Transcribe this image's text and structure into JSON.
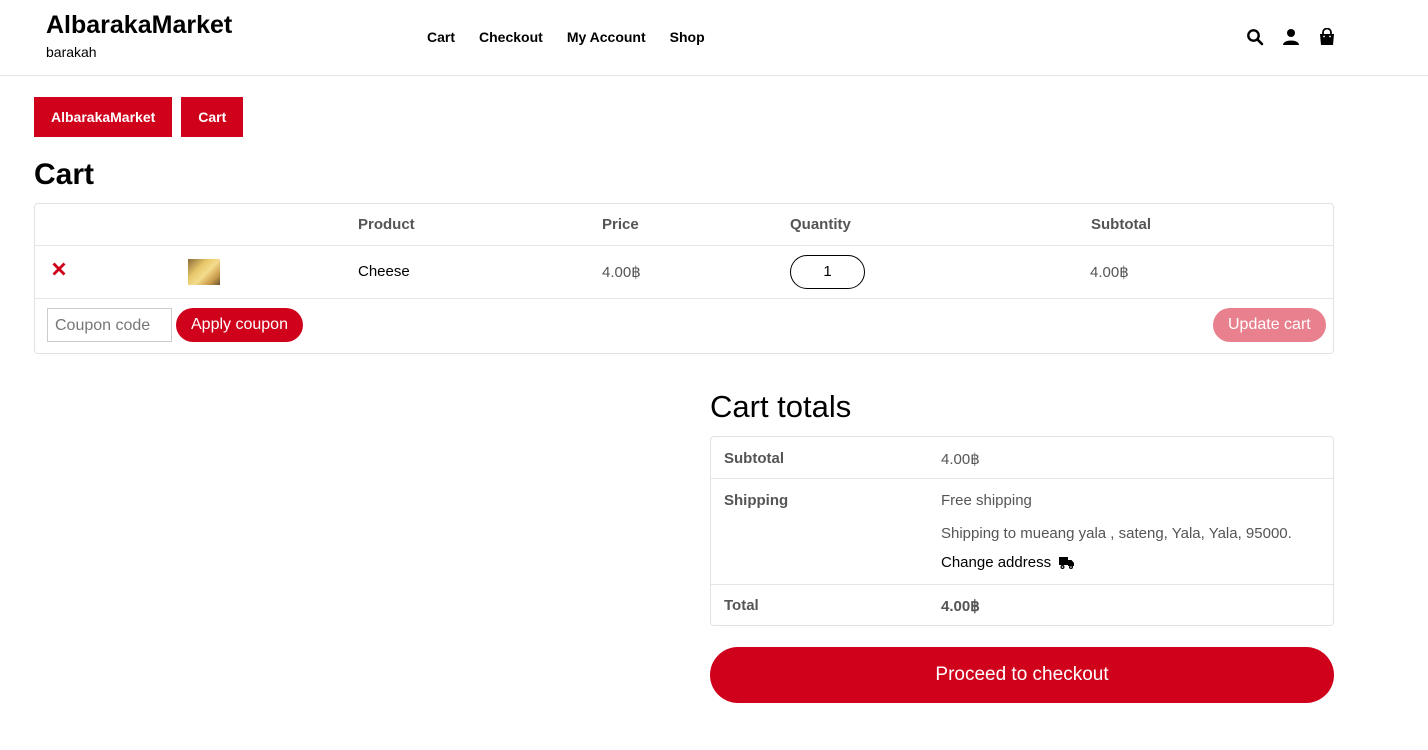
{
  "header": {
    "site_title": "AlbarakaMarket",
    "tagline": "barakah",
    "nav": [
      "Cart",
      "Checkout",
      "My Account",
      "Shop"
    ],
    "icons": [
      "search-icon",
      "account-icon",
      "bag-icon"
    ]
  },
  "breadcrumb": [
    "AlbarakaMarket",
    "Cart"
  ],
  "page_title": "Cart",
  "cart": {
    "columns": [
      "Product",
      "Price",
      "Quantity",
      "Subtotal"
    ],
    "rows": [
      {
        "product": "Cheese",
        "price": "4.00฿",
        "quantity": "1",
        "subtotal": "4.00฿"
      }
    ],
    "coupon_placeholder": "Coupon code",
    "apply_coupon_label": "Apply coupon",
    "update_cart_label": "Update cart"
  },
  "totals": {
    "title": "Cart totals",
    "subtotal_label": "Subtotal",
    "subtotal_value": "4.00฿",
    "shipping_label": "Shipping",
    "shipping_method": "Free shipping",
    "shipping_destination": "Shipping to mueang yala , sateng, Yala, Yala, 95000.",
    "change_address_label": "Change address",
    "total_label": "Total",
    "total_value": "4.00฿",
    "checkout_label": "Proceed to checkout"
  },
  "colors": {
    "accent": "#d0011b",
    "accent_disabled": "#e9808d"
  }
}
